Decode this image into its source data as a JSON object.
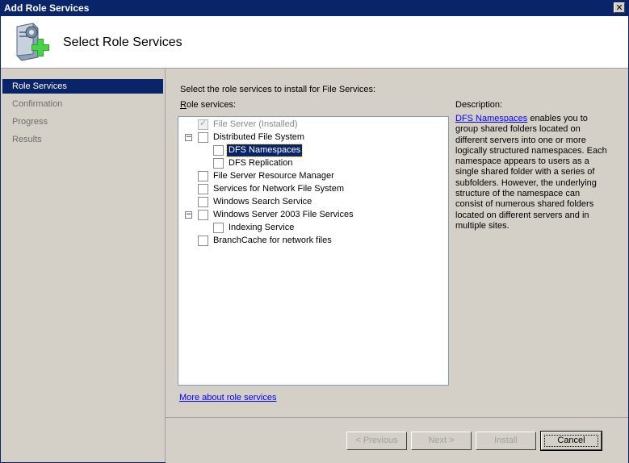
{
  "window": {
    "title": "Add Role Services",
    "close_symbol": "✕"
  },
  "header": {
    "title": "Select Role Services",
    "icon": "server-add-icon"
  },
  "sidebar": {
    "items": [
      {
        "label": "Role Services",
        "active": true
      },
      {
        "label": "Confirmation",
        "active": false
      },
      {
        "label": "Progress",
        "active": false
      },
      {
        "label": "Results",
        "active": false
      }
    ]
  },
  "main": {
    "instruction": "Select the role services to install for File Services:",
    "tree_label": "Role services:",
    "tree": [
      {
        "label": "File Server  (Installed)",
        "checked": true,
        "disabled": true
      },
      {
        "label": "Distributed File System",
        "expander": "−"
      },
      {
        "label": "DFS Namespaces",
        "selected": true
      },
      {
        "label": "DFS Replication"
      },
      {
        "label": "File Server Resource Manager"
      },
      {
        "label": "Services for Network File System"
      },
      {
        "label": "Windows Search Service"
      },
      {
        "label": "Windows Server 2003 File Services",
        "expander": "−"
      },
      {
        "label": "Indexing Service"
      },
      {
        "label": "BranchCache for network files"
      }
    ],
    "more_link": "More about role services",
    "description_label": "Description:",
    "description_link": "DFS Namespaces",
    "description_text": " enables you to group shared folders located on different servers into one or more logically structured namespaces. Each namespace appears to users as a single shared folder with a series of subfolders. However, the underlying structure of the namespace can consist of numerous shared folders located on different servers and in multiple sites."
  },
  "footer": {
    "previous": "< Previous",
    "next": "Next >",
    "install": "Install",
    "cancel": "Cancel"
  },
  "colors": {
    "title_bar": "#0a246a",
    "selection": "#0a246a",
    "dialog_face": "#d4d0c8",
    "link": "#0000ff"
  }
}
